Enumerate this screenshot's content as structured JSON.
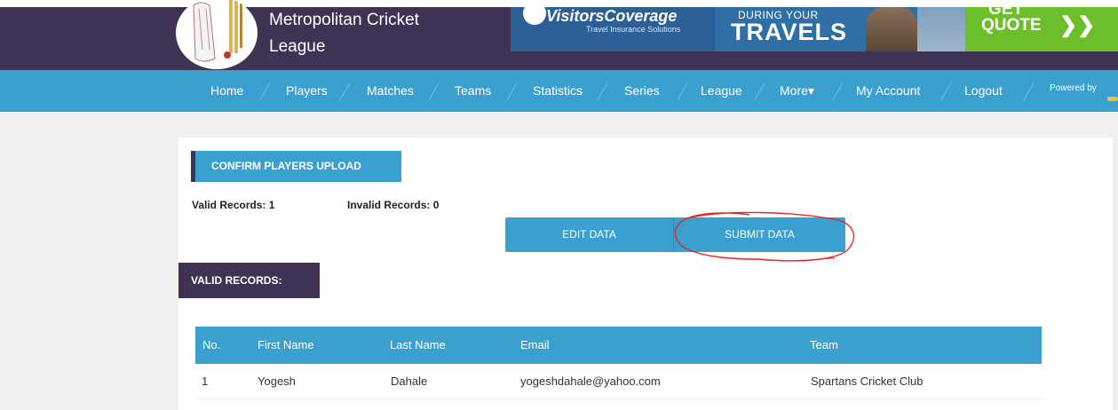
{
  "header": {
    "league_line1": "Metropolitan Cricket",
    "league_line2": "League"
  },
  "ad": {
    "brand": "VisitorsCoverage",
    "sub": "Travel Insurance Solutions",
    "during": "DURING YOUR",
    "travels": "TRAVELS",
    "get": "GET",
    "quote": "QUOTE",
    "arrows": "❯❯"
  },
  "nav": {
    "items": [
      {
        "label": "Home"
      },
      {
        "label": "Players"
      },
      {
        "label": "Matches"
      },
      {
        "label": "Teams"
      },
      {
        "label": "Statistics"
      },
      {
        "label": "Series"
      },
      {
        "label": "League"
      },
      {
        "label": "More▾"
      },
      {
        "label": "My Account"
      },
      {
        "label": "Logout"
      }
    ],
    "powered_by": "Powered by"
  },
  "page": {
    "confirm_title": "CONFIRM PLAYERS UPLOAD",
    "valid_records": "Valid Records: 1",
    "invalid_records": "Invalid Records: 0",
    "edit_button": "EDIT DATA",
    "submit_button": "SUBMIT DATA",
    "valid_section": "VALID RECORDS:"
  },
  "table": {
    "columns": [
      "No.",
      "First Name",
      "Last Name",
      "Email",
      "Team"
    ],
    "rows": [
      [
        "1",
        "Yogesh",
        "Dahale",
        "yogeshdahale@yahoo.com",
        "Spartans Cricket Club"
      ]
    ]
  },
  "colors": {
    "header_bg": "#3f3354",
    "nav_bg": "#3aa0cf",
    "annotation": "#e0282a"
  }
}
